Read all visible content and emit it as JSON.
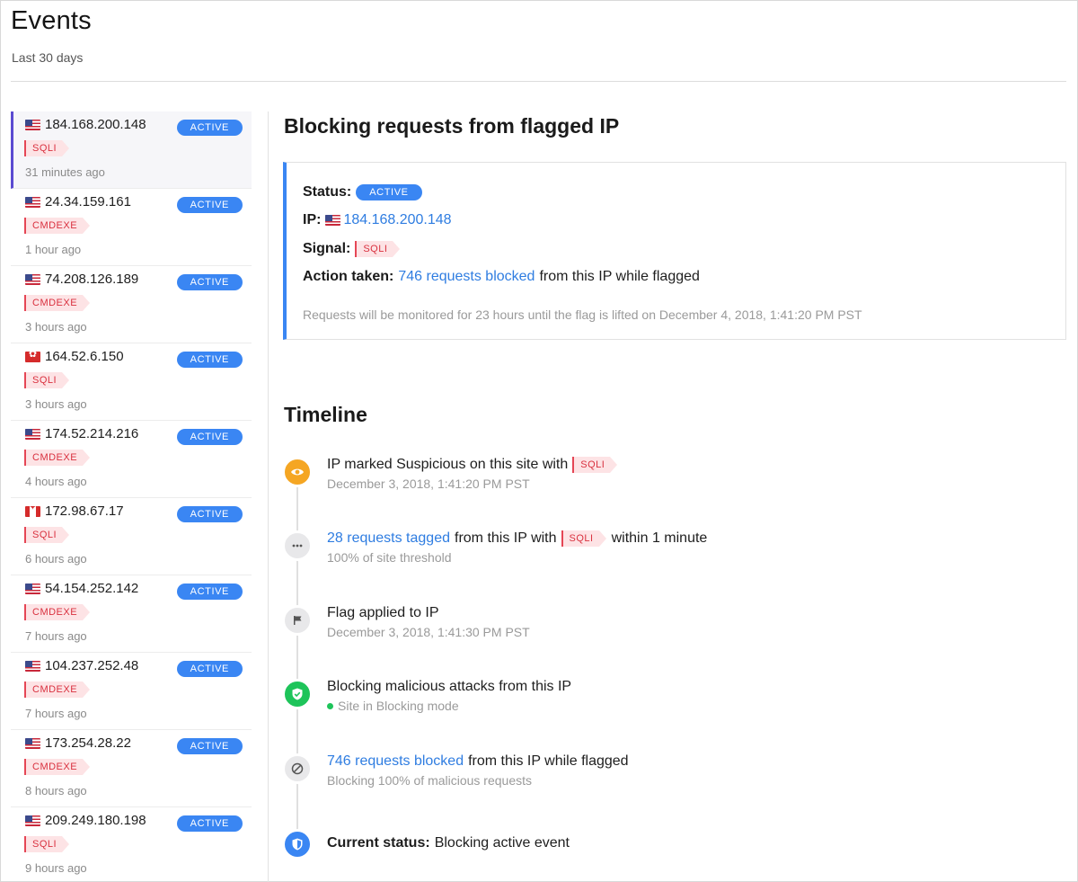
{
  "page": {
    "title": "Events",
    "subtitle": "Last 30 days"
  },
  "events": [
    {
      "flag": "us",
      "ip": "184.168.200.148",
      "status": "ACTIVE",
      "signal": "SQLI",
      "time": "31 minutes ago",
      "selected": true
    },
    {
      "flag": "us",
      "ip": "24.34.159.161",
      "status": "ACTIVE",
      "signal": "CMDEXE",
      "time": "1 hour ago"
    },
    {
      "flag": "us",
      "ip": "74.208.126.189",
      "status": "ACTIVE",
      "signal": "CMDEXE",
      "time": "3 hours ago"
    },
    {
      "flag": "hk",
      "ip": "164.52.6.150",
      "status": "ACTIVE",
      "signal": "SQLI",
      "time": "3 hours ago"
    },
    {
      "flag": "us",
      "ip": "174.52.214.216",
      "status": "ACTIVE",
      "signal": "CMDEXE",
      "time": "4 hours ago"
    },
    {
      "flag": "ca",
      "ip": "172.98.67.17",
      "status": "ACTIVE",
      "signal": "SQLI",
      "time": "6 hours ago"
    },
    {
      "flag": "us",
      "ip": "54.154.252.142",
      "status": "ACTIVE",
      "signal": "CMDEXE",
      "time": "7 hours ago"
    },
    {
      "flag": "us",
      "ip": "104.237.252.48",
      "status": "ACTIVE",
      "signal": "CMDEXE",
      "time": "7 hours ago"
    },
    {
      "flag": "us",
      "ip": "173.254.28.22",
      "status": "ACTIVE",
      "signal": "CMDEXE",
      "time": "8 hours ago"
    },
    {
      "flag": "us",
      "ip": "209.249.180.198",
      "status": "ACTIVE",
      "signal": "SQLI",
      "time": "9 hours ago"
    }
  ],
  "detail": {
    "title": "Blocking requests from flagged IP",
    "status_label": "Status:",
    "status": "ACTIVE",
    "ip_label": "IP:",
    "ip": "184.168.200.148",
    "signal_label": "Signal:",
    "signal": "SQLI",
    "action_label": "Action taken:",
    "action_link": "746 requests blocked",
    "action_rest": "from this IP while flagged",
    "note": "Requests will be monitored for 23 hours until the flag is lifted on December 4, 2018, 1:41:20 PM PST"
  },
  "timeline": {
    "title": "Timeline",
    "items": [
      {
        "icon": "eye-icon",
        "color": "#f5a623",
        "main_pre": "IP marked Suspicious on this site with",
        "tag": "SQLI",
        "sub": "December 3, 2018, 1:41:20 PM PST"
      },
      {
        "icon": "ellipsis-icon",
        "color": "#e8e8ea",
        "main_link": "28 requests tagged",
        "main_mid": "from this IP with",
        "tag": "SQLI",
        "main_post": "within 1 minute",
        "sub": "100% of site threshold"
      },
      {
        "icon": "flag-icon",
        "color": "#e8e8ea",
        "main_pre": "Flag applied to IP",
        "sub": "December 3, 2018, 1:41:30 PM PST"
      },
      {
        "icon": "shield-check-icon",
        "color": "#1ec45a",
        "main_pre": "Blocking malicious attacks from this IP",
        "sub": "Site in Blocking mode"
      },
      {
        "icon": "block-icon",
        "color": "#e8e8ea",
        "main_link": "746 requests blocked",
        "main_mid": "from this IP while flagged",
        "sub": "Blocking 100% of malicious requests"
      },
      {
        "icon": "shield-icon",
        "color": "#3a86f3",
        "main_bold": "Current status:",
        "main_pre": "Blocking active event"
      }
    ]
  }
}
